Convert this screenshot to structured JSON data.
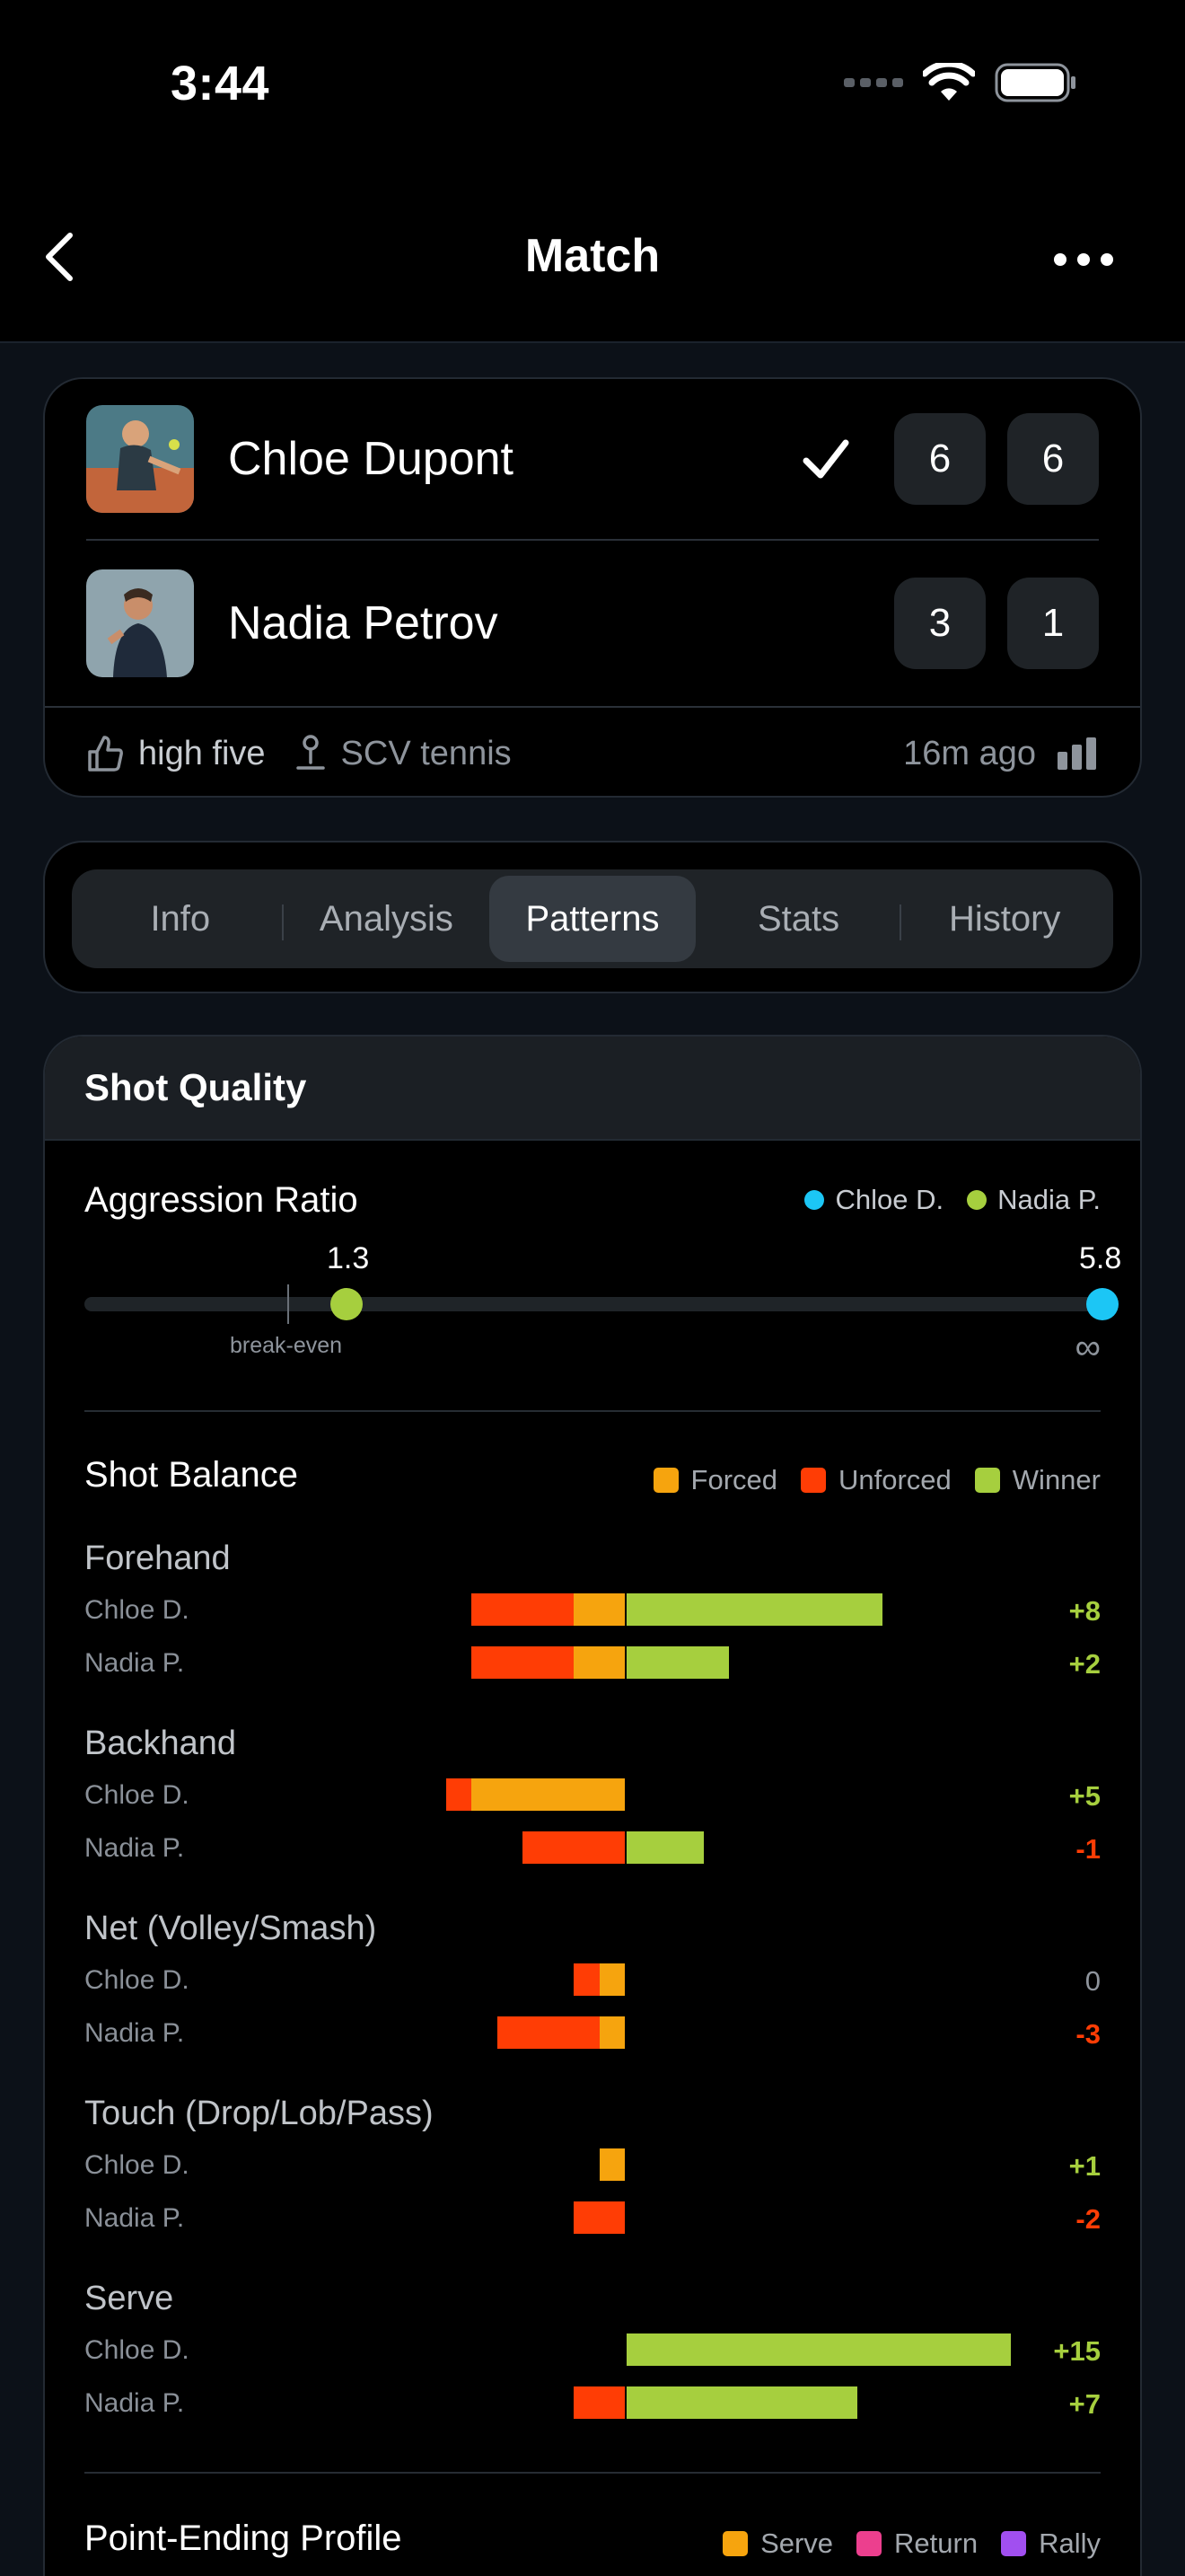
{
  "status": {
    "time": "3:44"
  },
  "nav": {
    "title": "Match"
  },
  "match": {
    "player1": {
      "name": "Chloe Dupont",
      "sets": [
        "6",
        "6"
      ],
      "winner": true
    },
    "player2": {
      "name": "Nadia Petrov",
      "sets": [
        "3",
        "1"
      ]
    },
    "reaction": "high five",
    "club": "SCV tennis",
    "time_ago": "16m ago"
  },
  "tabs": [
    {
      "label": "Info",
      "active": false
    },
    {
      "label": "Analysis",
      "active": false
    },
    {
      "label": "Patterns",
      "active": true
    },
    {
      "label": "Stats",
      "active": false
    },
    {
      "label": "History",
      "active": false
    }
  ],
  "shot_quality": {
    "title": "Shot Quality",
    "aggression": {
      "title": "Aggression Ratio",
      "legend": [
        {
          "label": "Chloe D.",
          "color": "#1cc6f5"
        },
        {
          "label": "Nadia P.",
          "color": "#a6cf3e"
        }
      ],
      "nadia_value": "1.3",
      "chloe_value": "5.8",
      "break_even_label": "break-even",
      "infinity_label": "∞"
    },
    "balance": {
      "title": "Shot Balance",
      "legend": [
        {
          "label": "Forced",
          "color": "#f6a40e"
        },
        {
          "label": "Unforced",
          "color": "#ff3d05"
        },
        {
          "label": "Winner",
          "color": "#a6cf3e"
        }
      ],
      "categories": [
        {
          "name": "Forehand",
          "rows": [
            {
              "player": "Chloe D.",
              "unforced": 4,
              "forced": 2,
              "winner": 10,
              "net": "+8",
              "tone": "pos"
            },
            {
              "player": "Nadia P.",
              "unforced": 4,
              "forced": 2,
              "winner": 4,
              "net": "+2",
              "tone": "pos"
            }
          ]
        },
        {
          "name": "Backhand",
          "rows": [
            {
              "player": "Chloe D.",
              "unforced": 1,
              "forced": 6,
              "winner": 0,
              "net": "+5",
              "tone": "pos"
            },
            {
              "player": "Nadia P.",
              "unforced": 4,
              "forced": 0,
              "winner": 3,
              "net": "-1",
              "tone": "neg"
            }
          ]
        },
        {
          "name": "Net (Volley/Smash)",
          "rows": [
            {
              "player": "Chloe D.",
              "unforced": 1,
              "forced": 1,
              "winner": 0,
              "net": "0",
              "tone": "zero"
            },
            {
              "player": "Nadia P.",
              "unforced": 4,
              "forced": 1,
              "winner": 0,
              "net": "-3",
              "tone": "neg"
            }
          ]
        },
        {
          "name": "Touch (Drop/Lob/Pass)",
          "rows": [
            {
              "player": "Chloe D.",
              "unforced": 0,
              "forced": 1,
              "winner": 0,
              "net": "+1",
              "tone": "pos"
            },
            {
              "player": "Nadia P.",
              "unforced": 2,
              "forced": 0,
              "winner": 0,
              "net": "-2",
              "tone": "neg"
            }
          ]
        },
        {
          "name": "Serve",
          "rows": [
            {
              "player": "Chloe D.",
              "unforced": 0,
              "forced": 0,
              "winner": 15,
              "net": "+15",
              "tone": "pos"
            },
            {
              "player": "Nadia P.",
              "unforced": 2,
              "forced": 0,
              "winner": 9,
              "net": "+7",
              "tone": "pos"
            }
          ]
        }
      ]
    },
    "point_ending": {
      "title": "Point-Ending Profile",
      "legend": [
        {
          "label": "Serve",
          "color": "#f6a40e"
        },
        {
          "label": "Return",
          "color": "#ec3f8e"
        },
        {
          "label": "Rally",
          "color": "#a14ff0"
        }
      ]
    }
  },
  "colors": {
    "pos": "#a6cf3e",
    "neg": "#ff3d05",
    "zero": "#8e949c"
  }
}
